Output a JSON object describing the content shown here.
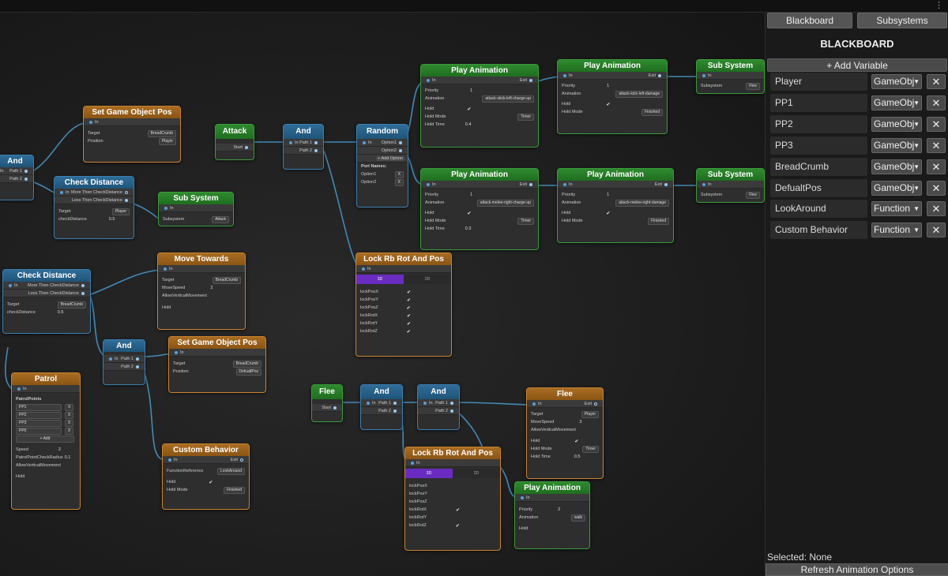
{
  "topbar": {
    "menu_icon": "kebab-menu-icon"
  },
  "sidebar": {
    "tab_blackboard": "Blackboard",
    "tab_subsystems": "Subsystems",
    "title": "BLACKBOARD",
    "add_variable": "+ Add Variable",
    "variables": [
      {
        "name": "Player",
        "type": "GameObj"
      },
      {
        "name": "PP1",
        "type": "GameObj"
      },
      {
        "name": "PP2",
        "type": "GameObj"
      },
      {
        "name": "PP3",
        "type": "GameObj"
      },
      {
        "name": "BreadCrumb",
        "type": "GameObj"
      },
      {
        "name": "DefualtPos",
        "type": "GameObj"
      },
      {
        "name": "LookAround",
        "type": "Function"
      },
      {
        "name": "Custom Behavior",
        "type": "Function"
      }
    ],
    "delete_label": "✕",
    "selected": "Selected: None",
    "refresh": "Refresh Animation Options"
  },
  "nodes": {
    "and_left": {
      "title": "And",
      "p1": "Path 1",
      "p2": "Path 2",
      "in": "In"
    },
    "set_pos1": {
      "title": "Set Game Object Pos",
      "in": "In",
      "target_l": "Target",
      "target_v": "BreadCrumb",
      "pos_l": "Position",
      "pos_v": "Player"
    },
    "check_dist1": {
      "title": "Check Distance",
      "in": "In",
      "more": "More Then CheckDistance",
      "less": "Less Then CheckDistance",
      "target_l": "Target",
      "target_v": "Player",
      "cd_l": "checkDistance",
      "cd_v": "0.5"
    },
    "sub_sys1": {
      "title": "Sub System",
      "in": "In",
      "ss_l": "Subsystem",
      "ss_v": "Attack"
    },
    "attack": {
      "title": "Attack",
      "start": "Start"
    },
    "and_attack": {
      "title": "And",
      "in": "In",
      "p1": "Path 1",
      "p2": "Path 2"
    },
    "random": {
      "title": "Random",
      "in": "In",
      "o1": "Option1",
      "o2": "Option2",
      "add": "+ Add Option",
      "names": "Port Names:",
      "n1": "Option1",
      "n2": "Option2",
      "x": "X"
    },
    "play1": {
      "title": "Play Animation",
      "in": "In",
      "exit": "Exit",
      "pr_l": "Priority",
      "pr_v": "1",
      "an_l": "Animation",
      "an_v": "attack-stick-left-charge-up",
      "h_l": "Hold",
      "h_v": "✔",
      "hm_l": "Hold Mode",
      "hm_v": "Timer",
      "ht_l": "Hold Time",
      "ht_v": "0.4"
    },
    "play2": {
      "title": "Play Animation",
      "in": "In",
      "exit": "Exit",
      "pr_l": "Priority",
      "pr_v": "1",
      "an_l": "Animation",
      "an_v": "attack-kick-left-damage",
      "h_l": "Hold",
      "h_v": "✔",
      "hm_l": "Hold Mode",
      "hm_v": "Finished"
    },
    "subsys2": {
      "title": "Sub System",
      "in": "In",
      "ss_l": "Subsystem",
      "ss_v": "Flee"
    },
    "play3": {
      "title": "Play Animation",
      "in": "In",
      "exit": "Exit",
      "pr_l": "Priority",
      "pr_v": "1",
      "an_l": "Animation",
      "an_v": "attack-melee-right-charge-up",
      "h_l": "Hold",
      "h_v": "✔",
      "hm_l": "Hold Mode",
      "hm_v": "Timer",
      "ht_l": "Hold Time",
      "ht_v": "0.3"
    },
    "play4": {
      "title": "Play Animation",
      "in": "In",
      "exit": "Exit",
      "pr_l": "Priority",
      "pr_v": "1",
      "an_l": "Animation",
      "an_v": "attack-melee-right-damage",
      "h_l": "Hold",
      "h_v": "✔",
      "hm_l": "Hold Mode",
      "hm_v": "Finished"
    },
    "subsys3": {
      "title": "Sub System",
      "in": "In",
      "ss_l": "Subsystem",
      "ss_v": "Flee"
    },
    "check_dist2": {
      "title": "Check Distance",
      "in": "In",
      "more": "More Then CheckDistance",
      "less": "Less Then CheckDistance",
      "target_l": "Target",
      "target_v": "BreadCrumb",
      "cd_l": "checkDistance",
      "cd_v": "0.5"
    },
    "move_towards": {
      "title": "Move Towards",
      "in": "In",
      "target_l": "Target",
      "target_v": "BreadCrumb",
      "ms_l": "MoveSpeed",
      "ms_v": "2",
      "avm_l": "AllowVerticalMovement",
      "hold_l": "Hold"
    },
    "lock1": {
      "title": "Lock Rb Rot And Pos",
      "in": "In",
      "tab3d": "3D",
      "tab2d": "2D",
      "rows": [
        {
          "l": "lockPosX",
          "v": "✔"
        },
        {
          "l": "lockPosY",
          "v": "✔"
        },
        {
          "l": "lockPosZ",
          "v": "✔"
        },
        {
          "l": "lockRotX",
          "v": "✔"
        },
        {
          "l": "lockRotY",
          "v": "✔"
        },
        {
          "l": "lockRotZ",
          "v": "✔"
        }
      ]
    },
    "and_mid": {
      "title": "And",
      "in": "In",
      "p1": "Path 1",
      "p2": "Path 2"
    },
    "set_pos2": {
      "title": "Set Game Object Pos",
      "in": "In",
      "target_l": "Target",
      "target_v": "BreadCrumb",
      "pos_l": "Position",
      "pos_v": "DefualtPos"
    },
    "patrol": {
      "title": "Patrol",
      "in": "In",
      "pp": "PatrolPoints",
      "items": [
        "PP1",
        "PP2",
        "PP3",
        "PP0"
      ],
      "x": "X",
      "add": "+ Add",
      "speed_l": "Speed",
      "speed_v": "2",
      "pcr_l": "PatrolPointCheckRadius",
      "pcr_v": "0.1",
      "avm_l": "AllowVerticalMovement",
      "hold_l": "Hold"
    },
    "custom": {
      "title": "Custom Behavior",
      "in": "In",
      "exit": "Exit",
      "fr_l": "FunctionReference",
      "fr_v": "LookAround",
      "h_l": "Hold",
      "h_v": "✔",
      "hm_l": "Hold Mode",
      "hm_v": "Finished"
    },
    "flee_start": {
      "title": "Flee",
      "start": "Start"
    },
    "and_flee1": {
      "title": "And",
      "in": "In",
      "p1": "Path 1",
      "p2": "Path 2"
    },
    "and_flee2": {
      "title": "And",
      "in": "In",
      "p1": "Path 1",
      "p2": "Path 2"
    },
    "flee": {
      "title": "Flee",
      "in": "In",
      "exit": "Exit",
      "target_l": "Target",
      "target_v": "Player",
      "ms_l": "MoveSpeed",
      "ms_v": "3",
      "avm_l": "AllowVerticalMovement",
      "h_l": "Hold",
      "h_v": "✔",
      "hm_l": "Hold Mode",
      "hm_v": "Timer",
      "ht_l": "Hold Time",
      "ht_v": "0.5"
    },
    "lock2": {
      "title": "Lock Rb Rot And Pos",
      "in": "In",
      "tab3d": "3D",
      "tab2d": "2D",
      "rows": [
        {
          "l": "lockPosX",
          "v": ""
        },
        {
          "l": "lockPosY",
          "v": ""
        },
        {
          "l": "lockPosZ",
          "v": ""
        },
        {
          "l": "lockRotX",
          "v": "✔"
        },
        {
          "l": "lockRotY",
          "v": ""
        },
        {
          "l": "lockRotZ",
          "v": "✔"
        }
      ]
    },
    "play5": {
      "title": "Play Animation",
      "in": "In",
      "pr_l": "Priority",
      "pr_v": "2",
      "an_l": "Animation",
      "an_v": "walk",
      "hold_l": "Hold"
    }
  },
  "colors": {
    "event": "#2f8a2f",
    "action": "#a86c22",
    "logic": "#2f6d98",
    "wire": "#4a9bd0",
    "accent": "#6a2cc0"
  }
}
